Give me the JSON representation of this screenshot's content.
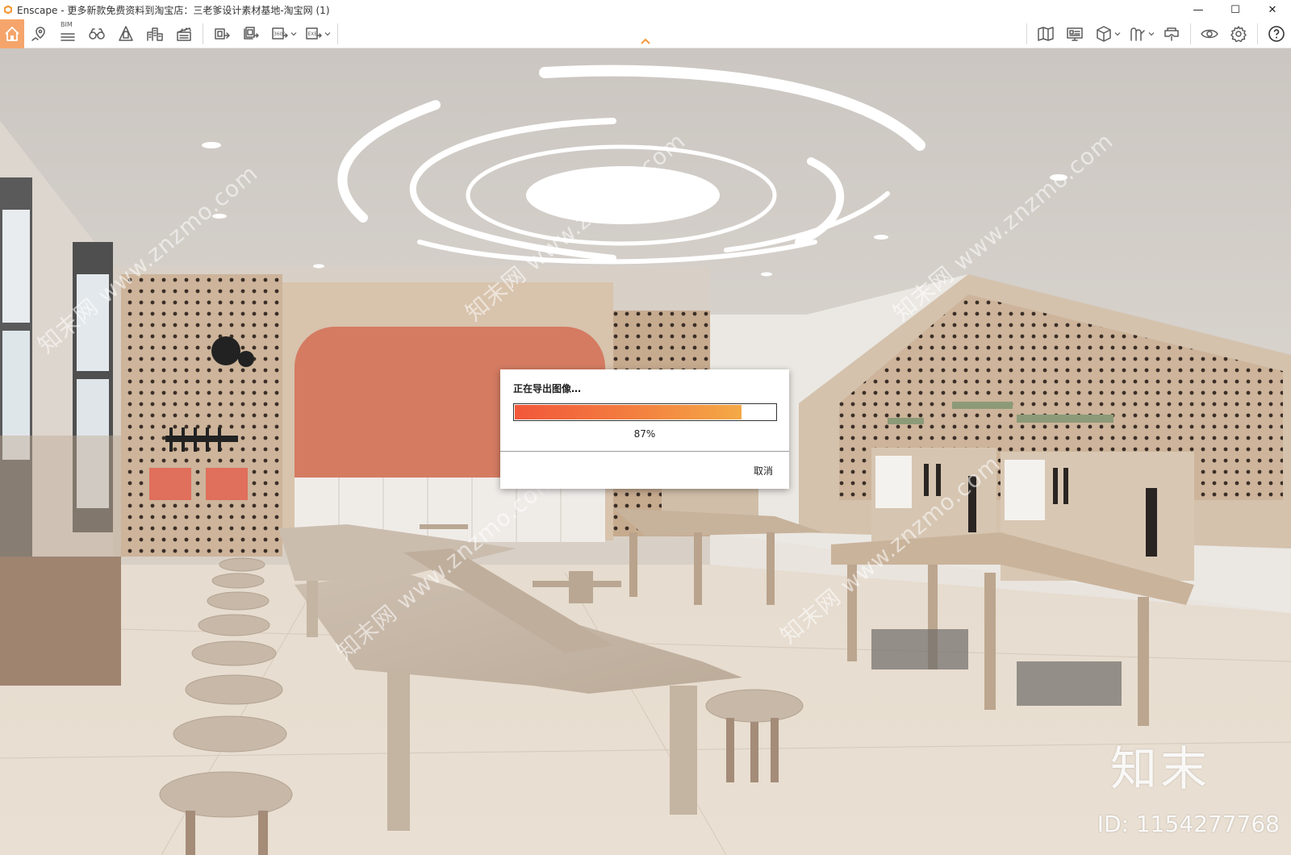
{
  "window": {
    "title": "Enscape - 更多新款免费资料到淘宝店：三老爹设计素材基地-淘宝网 (1)",
    "minimize": "—",
    "maximize": "☐",
    "close": "✕"
  },
  "toolbar": {
    "bim_label": "BIM",
    "left_icons": [
      "home-icon",
      "location-pin-icon",
      "bim-icon",
      "binoculars-icon",
      "shield-icon",
      "buildings-icon",
      "clapper-icon",
      "screenshot-export-icon",
      "batch-render-icon",
      "panorama-360-icon",
      "export-exe-icon"
    ],
    "right_icons": [
      "map-icon",
      "monitor-icon",
      "cube-view-icon",
      "asset-library-icon",
      "vr-headset-icon",
      "visibility-eye-icon",
      "settings-gear-icon",
      "help-icon"
    ],
    "accent_color": "#f5a56b"
  },
  "dialog": {
    "title": "正在导出图像…",
    "progress": 0.87,
    "progress_text": "87%",
    "cancel_label": "取消"
  },
  "watermarks": {
    "site": "知末网 www.znzmo.com",
    "brand": "知末",
    "id": "ID: 1154277768"
  }
}
